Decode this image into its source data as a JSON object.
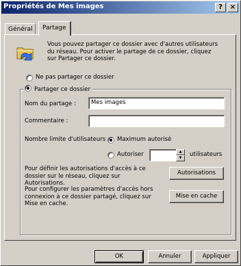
{
  "window": {
    "title": "Propriétés de Mes images"
  },
  "titlebar_buttons": {
    "help": "?",
    "close": "×"
  },
  "tabs": [
    {
      "label": "Général",
      "active": false
    },
    {
      "label": "Partage",
      "active": true
    }
  ],
  "intro_text": "Vous pouvez partager ce dossier avec d'autres utilisateurs du réseau. Pour activer le partage de ce dossier, cliquez sur Partager ce dossier.",
  "sharing": {
    "no_share_label": "Ne pas partager ce dossier",
    "share_label": "Partager ce dossier",
    "selected": "share"
  },
  "share_name": {
    "label": "Nom du partage :",
    "value": "Mes images"
  },
  "comment": {
    "label": "Commentaire :",
    "value": ""
  },
  "user_limit": {
    "label": "Nombre limite d'utilisateurs :",
    "max_label": "Maximum autorisé",
    "allow_label": "Autoriser",
    "count_value": "",
    "units": "utilisateurs",
    "selected": "max"
  },
  "permissions": {
    "text": "Pour définir les autorisations d'accès à ce dossier sur le réseau, cliquez sur Autorisations.",
    "button": "Autorisations"
  },
  "caching": {
    "text": "Pour configurer les paramètres d'accès hors connexion à ce dossier partagé, cliquez sur Mise en cache.",
    "button": "Mise en cache"
  },
  "dialog_buttons": {
    "ok": "OK",
    "cancel": "Annuler",
    "apply": "Appliquer"
  },
  "colors": {
    "face": "#d4d0c8",
    "title_start": "#0a246a",
    "title_end": "#a6caf0"
  }
}
